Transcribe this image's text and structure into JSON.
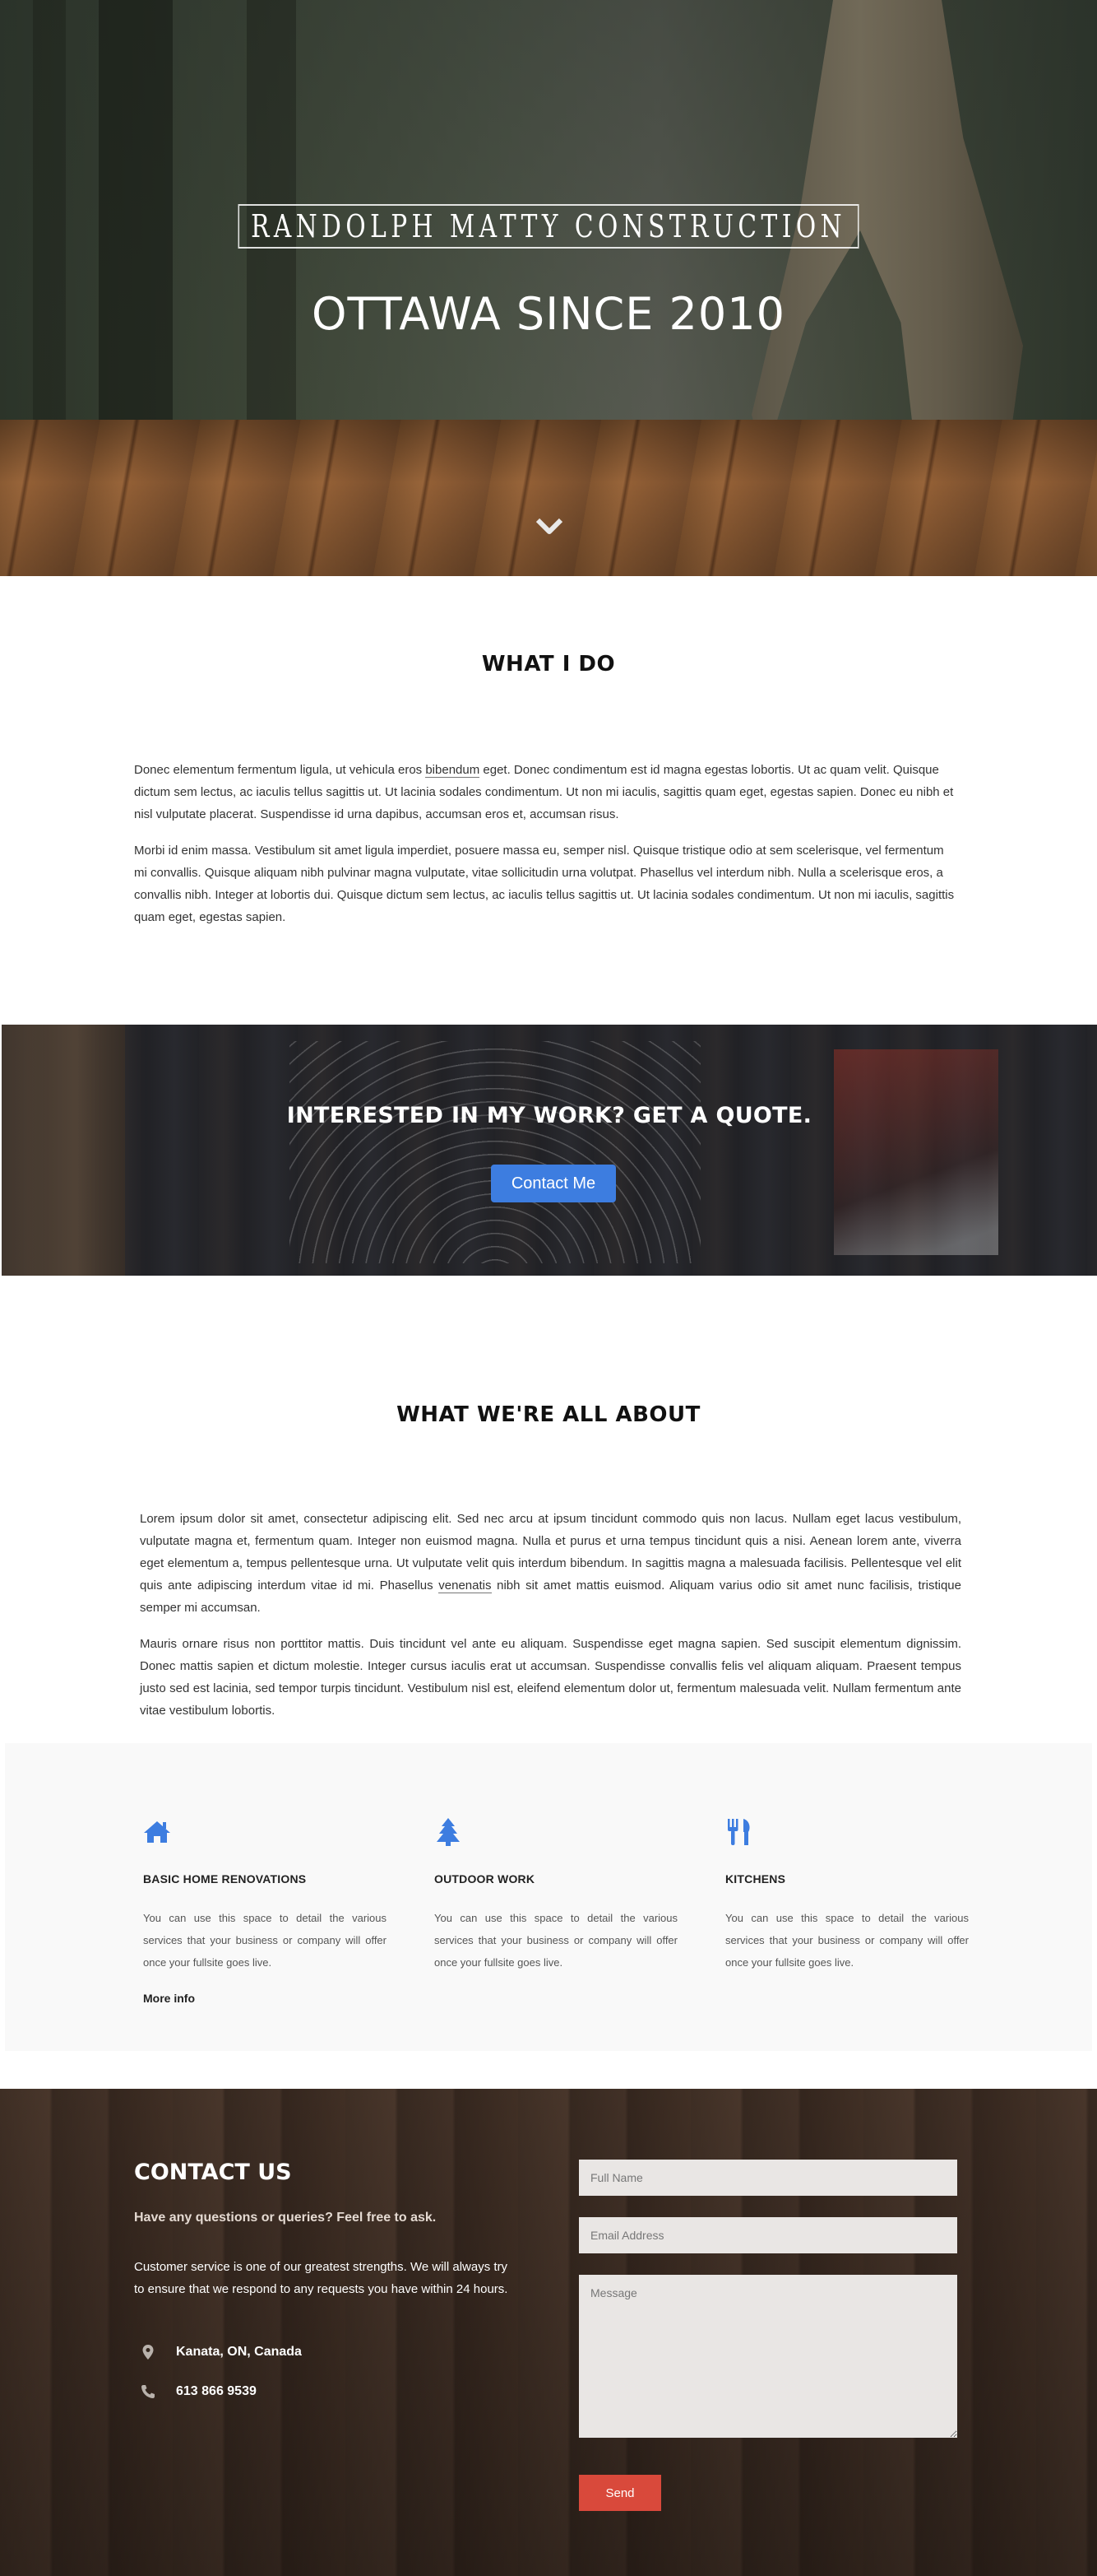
{
  "hero": {
    "brand": "RANDOLPH MATTY CONSTRUCTION",
    "tagline": "OTTAWA SINCE 2010",
    "scroll_icon": "chevron-down-icon"
  },
  "what_i_do": {
    "title": "WHAT I DO",
    "p1_a": "Donec elementum fermentum ligula, ut vehicula eros ",
    "p1_link": "bibendum",
    "p1_b": " eget. Donec condimentum est id magna egestas lobortis. Ut ac quam velit. Quisque dictum sem lectus, ac iaculis tellus sagittis ut. Ut lacinia sodales condimentum. Ut non mi iaculis, sagittis quam eget, egestas sapien. Donec eu nibh et nisl vulputate placerat. Suspendisse id urna dapibus, accumsan eros et, accumsan risus.",
    "p2": "Morbi id enim massa. Vestibulum sit amet ligula imperdiet, posuere massa eu, semper nisl. Quisque tristique odio at sem scelerisque, vel fermentum mi convallis. Quisque aliquam nibh pulvinar magna vulputate, vitae sollicitudin urna volutpat. Phasellus vel interdum nibh. Nulla a scelerisque eros, a convallis nibh. Integer at lobortis dui. Quisque dictum sem lectus, ac iaculis tellus sagittis ut. Ut lacinia sodales condimentum. Ut non mi iaculis, sagittis quam eget, egestas sapien."
  },
  "cta": {
    "title": "INTERESTED IN MY WORK? GET A QUOTE.",
    "button_label": "Contact Me"
  },
  "about": {
    "title": "WHAT WE'RE ALL ABOUT",
    "p1_a": "Lorem ipsum dolor sit amet, consectetur adipiscing elit. Sed nec arcu at ipsum tincidunt commodo quis non lacus. Nullam eget lacus vestibulum, vulputate magna et, fermentum quam. Integer non euismod magna. Nulla et purus et urna tempus tincidunt quis a nisi. Aenean lorem ante, viverra eget elementum a, tempus pellentesque urna. Ut vulputate velit quis interdum bibendum. In sagittis magna a malesuada facilisis. Pellentesque vel elit quis ante adipiscing interdum vitae id mi. Phasellus ",
    "p1_link": "venenatis",
    "p1_b": " nibh sit amet mattis euismod. Aliquam varius odio sit amet nunc facilisis, tristique semper mi accumsan.",
    "p2": "Mauris ornare risus non porttitor mattis. Duis tincidunt vel ante eu aliquam. Suspendisse eget magna sapien. Sed suscipit elementum dignissim. Donec mattis sapien et dictum molestie. Integer cursus iaculis erat ut accumsan. Suspendisse convallis felis vel aliquam aliquam. Praesent tempus justo sed est lacinia, sed tempor turpis tincidunt. Vestibulum nisl est, eleifend elementum dolor ut, fermentum malesuada velit. Nullam fermentum ante vitae vestibulum lobortis."
  },
  "features": [
    {
      "icon": "home-icon",
      "title": "BASIC HOME RENOVATIONS",
      "text": "You can use this space to detail the various services that your business or company will offer once your fullsite goes live.",
      "more": "More info"
    },
    {
      "icon": "tree-icon",
      "title": "OUTDOOR WORK",
      "text": "You can use this space to detail the various services that your business or company will offer once your fullsite goes live."
    },
    {
      "icon": "fork-knife-icon",
      "title": "KITCHENS",
      "text": "You can use this space to detail the various services that your business or company will offer once your fullsite goes live."
    }
  ],
  "colors": {
    "accent_blue": "#3d7de0",
    "send_red": "#d9493b"
  },
  "contact": {
    "title": "CONTACT US",
    "subtitle": "Have any questions or queries? Feel free to ask.",
    "description": "Customer service is one of our greatest strengths. We will always try to ensure that we respond to any requests you have within 24 hours.",
    "location": "Kanata, ON, Canada",
    "phone": "613 866 9539",
    "form": {
      "name_placeholder": "Full Name",
      "email_placeholder": "Email Address",
      "message_placeholder": "Message",
      "send_label": "Send"
    }
  }
}
